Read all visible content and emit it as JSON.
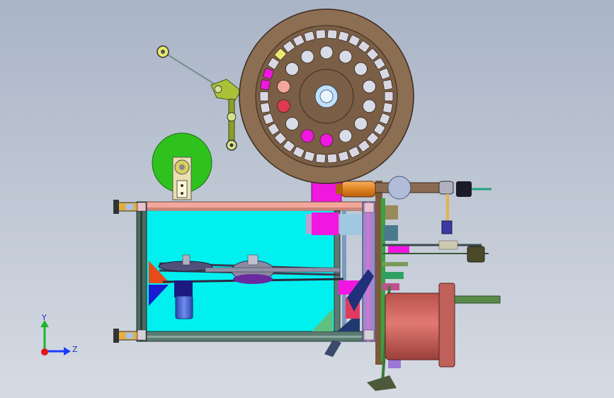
{
  "view": {
    "background_top": "#a9b4c6",
    "background_bottom": "#d6dbe3"
  },
  "triad": {
    "x_label": "Z",
    "y_label": "Y",
    "x_color": "#1a3cff",
    "y_color": "#1bb52a",
    "origin_color": "#e01818"
  },
  "model": {
    "icons": [
      "spool-wheel",
      "tension-arm",
      "pulley-disc",
      "frame-rail",
      "motor",
      "belt-drive",
      "servo-motor",
      "linkage-arm"
    ],
    "colors": {
      "spool": "#8c6e52",
      "spool_dark": "#6a513c",
      "frame_fill": "#00f0f0",
      "frame_rail": "#4c6b62",
      "rail_top": "#f2a79a",
      "green_disc": "#2fc21e",
      "magenta": "#f018e0",
      "motor_body": "#d36a64",
      "motor_blue": "#3b5fd6",
      "orange": "#e8902a",
      "olive": "#a9c238"
    }
  }
}
